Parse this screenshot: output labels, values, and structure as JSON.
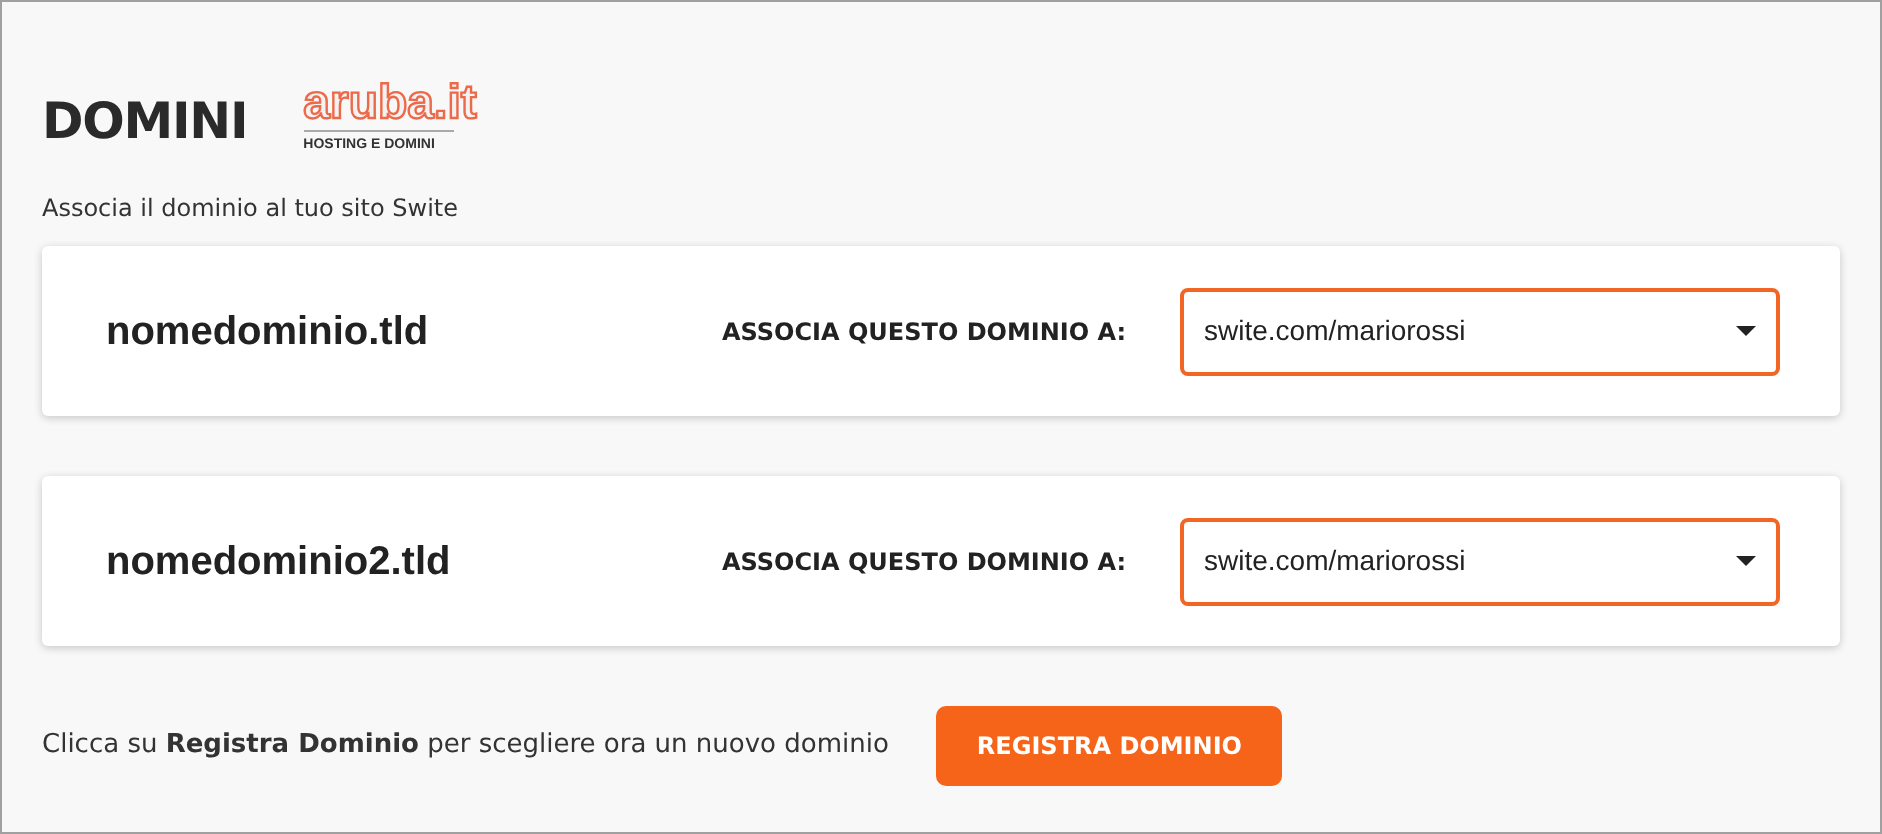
{
  "title": "DOMINI",
  "logo": {
    "name": "aruba.it",
    "tagline": "HOSTING E DOMINI"
  },
  "subtitle": "Associa il dominio al tuo sito Swite",
  "domains": [
    {
      "name": "nomedominio.tld",
      "label": "ASSOCIA QUESTO DOMINIO A:",
      "value": "swite.com/mariorossi"
    },
    {
      "name": "nomedominio2.tld",
      "label": "ASSOCIA QUESTO DOMINIO A:",
      "value": "swite.com/mariorossi"
    }
  ],
  "footer": {
    "text": "Clicca su **Registra Dominio** per scegliere ora un nuovo dominio",
    "button": "REGISTRA DOMINIO"
  }
}
